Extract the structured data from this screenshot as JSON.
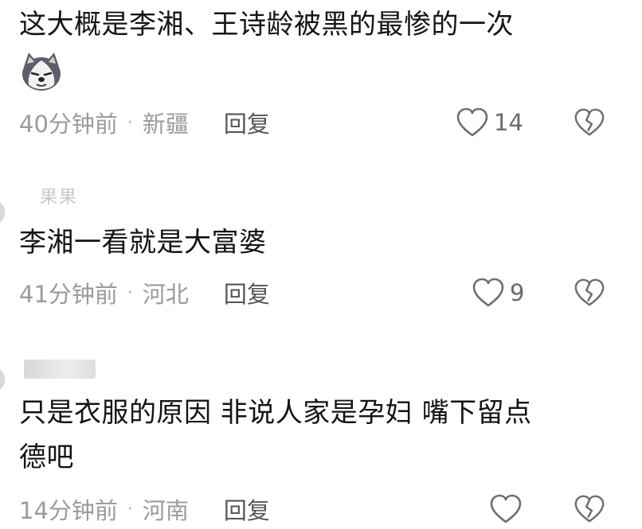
{
  "comments": [
    {
      "text": "这大概是李湘、王诗龄被黑的最惨的一次",
      "time": "40分钟前",
      "location": "新疆",
      "reply_label": "回复",
      "likes": "14",
      "sticker": "husky-dog-sticker"
    },
    {
      "username": "果果",
      "text": "李湘一看就是大富婆",
      "time": "41分钟前",
      "location": "河北",
      "reply_label": "回复",
      "likes": "9"
    },
    {
      "text_line1": "只是衣服的原因 非说人家是孕妇 嘴下留点",
      "text_line2": "德吧",
      "time": "14分钟前",
      "location": "河南",
      "reply_label": "回复",
      "likes": ""
    }
  ],
  "separator": "·",
  "icons": {
    "like": "heart-outline-icon",
    "dislike": "broken-heart-icon"
  },
  "colors": {
    "text": "#141414",
    "meta": "#9b9b9b",
    "reply": "#555555",
    "icon": "#777777"
  }
}
